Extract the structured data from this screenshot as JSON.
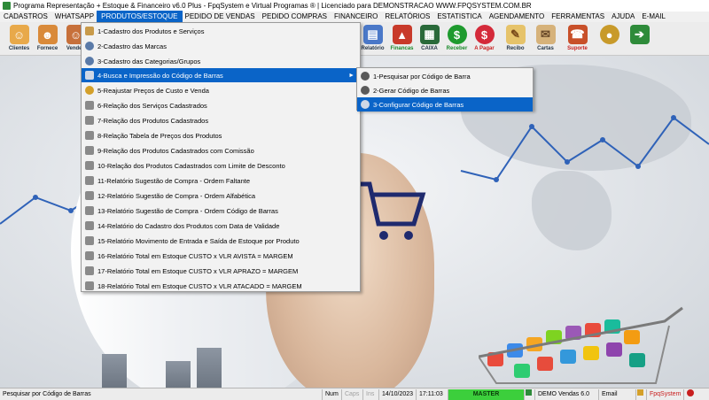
{
  "window": {
    "title": "Programa Representação + Estoque & Financeiro v6.0 Plus - FpqSystem e Virtual Programas ® | Licenciado para  DEMONSTRACAO  WWW.FPQSYSTEM.COM.BR"
  },
  "menubar": {
    "items": [
      {
        "label": "CADASTROS",
        "active": false
      },
      {
        "label": "WHATSAPP",
        "active": false
      },
      {
        "label": "PRODUTOS/ESTOQUE",
        "active": true
      },
      {
        "label": "PEDIDO DE VENDAS",
        "active": false
      },
      {
        "label": "PEDIDO COMPRAS",
        "active": false
      },
      {
        "label": "FINANCEIRO",
        "active": false
      },
      {
        "label": "RELATÓRIOS",
        "active": false
      },
      {
        "label": "ESTATISTICA",
        "active": false
      },
      {
        "label": "AGENDAMENTO",
        "active": false
      },
      {
        "label": "FERRAMENTAS",
        "active": false
      },
      {
        "label": "AJUDA",
        "active": false
      },
      {
        "label": "E-MAIL",
        "active": false
      }
    ]
  },
  "toolbar": {
    "clientes": "Clientes",
    "fornece": "Fornece",
    "vended": "Vended",
    "relatorio": "Relatório",
    "financas": "Financas",
    "caixa": "CAIXA",
    "receber": "Receber",
    "apagar": "A Pagar",
    "recibo": "Recibo",
    "cartas": "Cartas",
    "suporte": "Suporte"
  },
  "dropdown": {
    "items": [
      {
        "label": "1-Cadastro dos Produtos e Serviços",
        "has_submenu": false
      },
      {
        "label": "2-Cadastro das Marcas",
        "has_submenu": false
      },
      {
        "label": "3-Cadastro das Categorias/Grupos",
        "has_submenu": false
      },
      {
        "label": "4-Busca e Impressão do Código de Barras",
        "has_submenu": true
      },
      {
        "label": "5-Reajustar Preços de Custo e Venda",
        "has_submenu": false
      },
      {
        "label": "6-Relação dos Serviços Cadastrados",
        "has_submenu": false
      },
      {
        "label": "7-Relação dos Produtos Cadastrados",
        "has_submenu": false
      },
      {
        "label": "8-Relação Tabela de Preços dos Produtos",
        "has_submenu": false
      },
      {
        "label": "9-Relação dos Produtos Cadastrados com Comissão",
        "has_submenu": false
      },
      {
        "label": "10-Relação dos Produtos Cadastrados com Limite de Desconto",
        "has_submenu": false
      },
      {
        "label": "11-Relatório Sugestão de Compra - Ordem Faltante",
        "has_submenu": false
      },
      {
        "label": "12-Relatório Sugestão de Compra - Ordem Alfabética",
        "has_submenu": false
      },
      {
        "label": "13-Relatório Sugestão de Compra - Ordem Código de Barras",
        "has_submenu": false
      },
      {
        "label": "14-Relatório do Cadastro dos Produtos com Data de Validade",
        "has_submenu": false
      },
      {
        "label": "15-Relatório Movimento de Entrada e Saída de Estoque por Produto",
        "has_submenu": false
      },
      {
        "label": "16-Relatório Total em Estoque CUSTO x VLR AVISTA = MARGEM",
        "has_submenu": false
      },
      {
        "label": "17-Relatório Total em Estoque CUSTO x VLR APRAZO = MARGEM",
        "has_submenu": false
      },
      {
        "label": "18-Relatório Total em Estoque CUSTO x VLR ATACADO = MARGEM",
        "has_submenu": false
      }
    ],
    "arrow": "►"
  },
  "submenu": {
    "items": [
      {
        "label": "1-Pesquisar por Código de Barra"
      },
      {
        "label": "2-Gerar Código de Barras"
      },
      {
        "label": "3-Configurar Código de Barras"
      }
    ]
  },
  "statusbar": {
    "hint": "Pesquisar por Código de Barras",
    "num": "Num",
    "caps": "Caps",
    "ins": "Ins",
    "date": "14/10/2023",
    "time": "17:11:03",
    "mode": "MASTER",
    "version": "DEMO Vendas 6.0",
    "email": "Email",
    "brand": "FpqSystem"
  },
  "colors": {
    "accent": "#0a64c8",
    "master": "#3ccf3c",
    "brand": "#c81e1e"
  }
}
